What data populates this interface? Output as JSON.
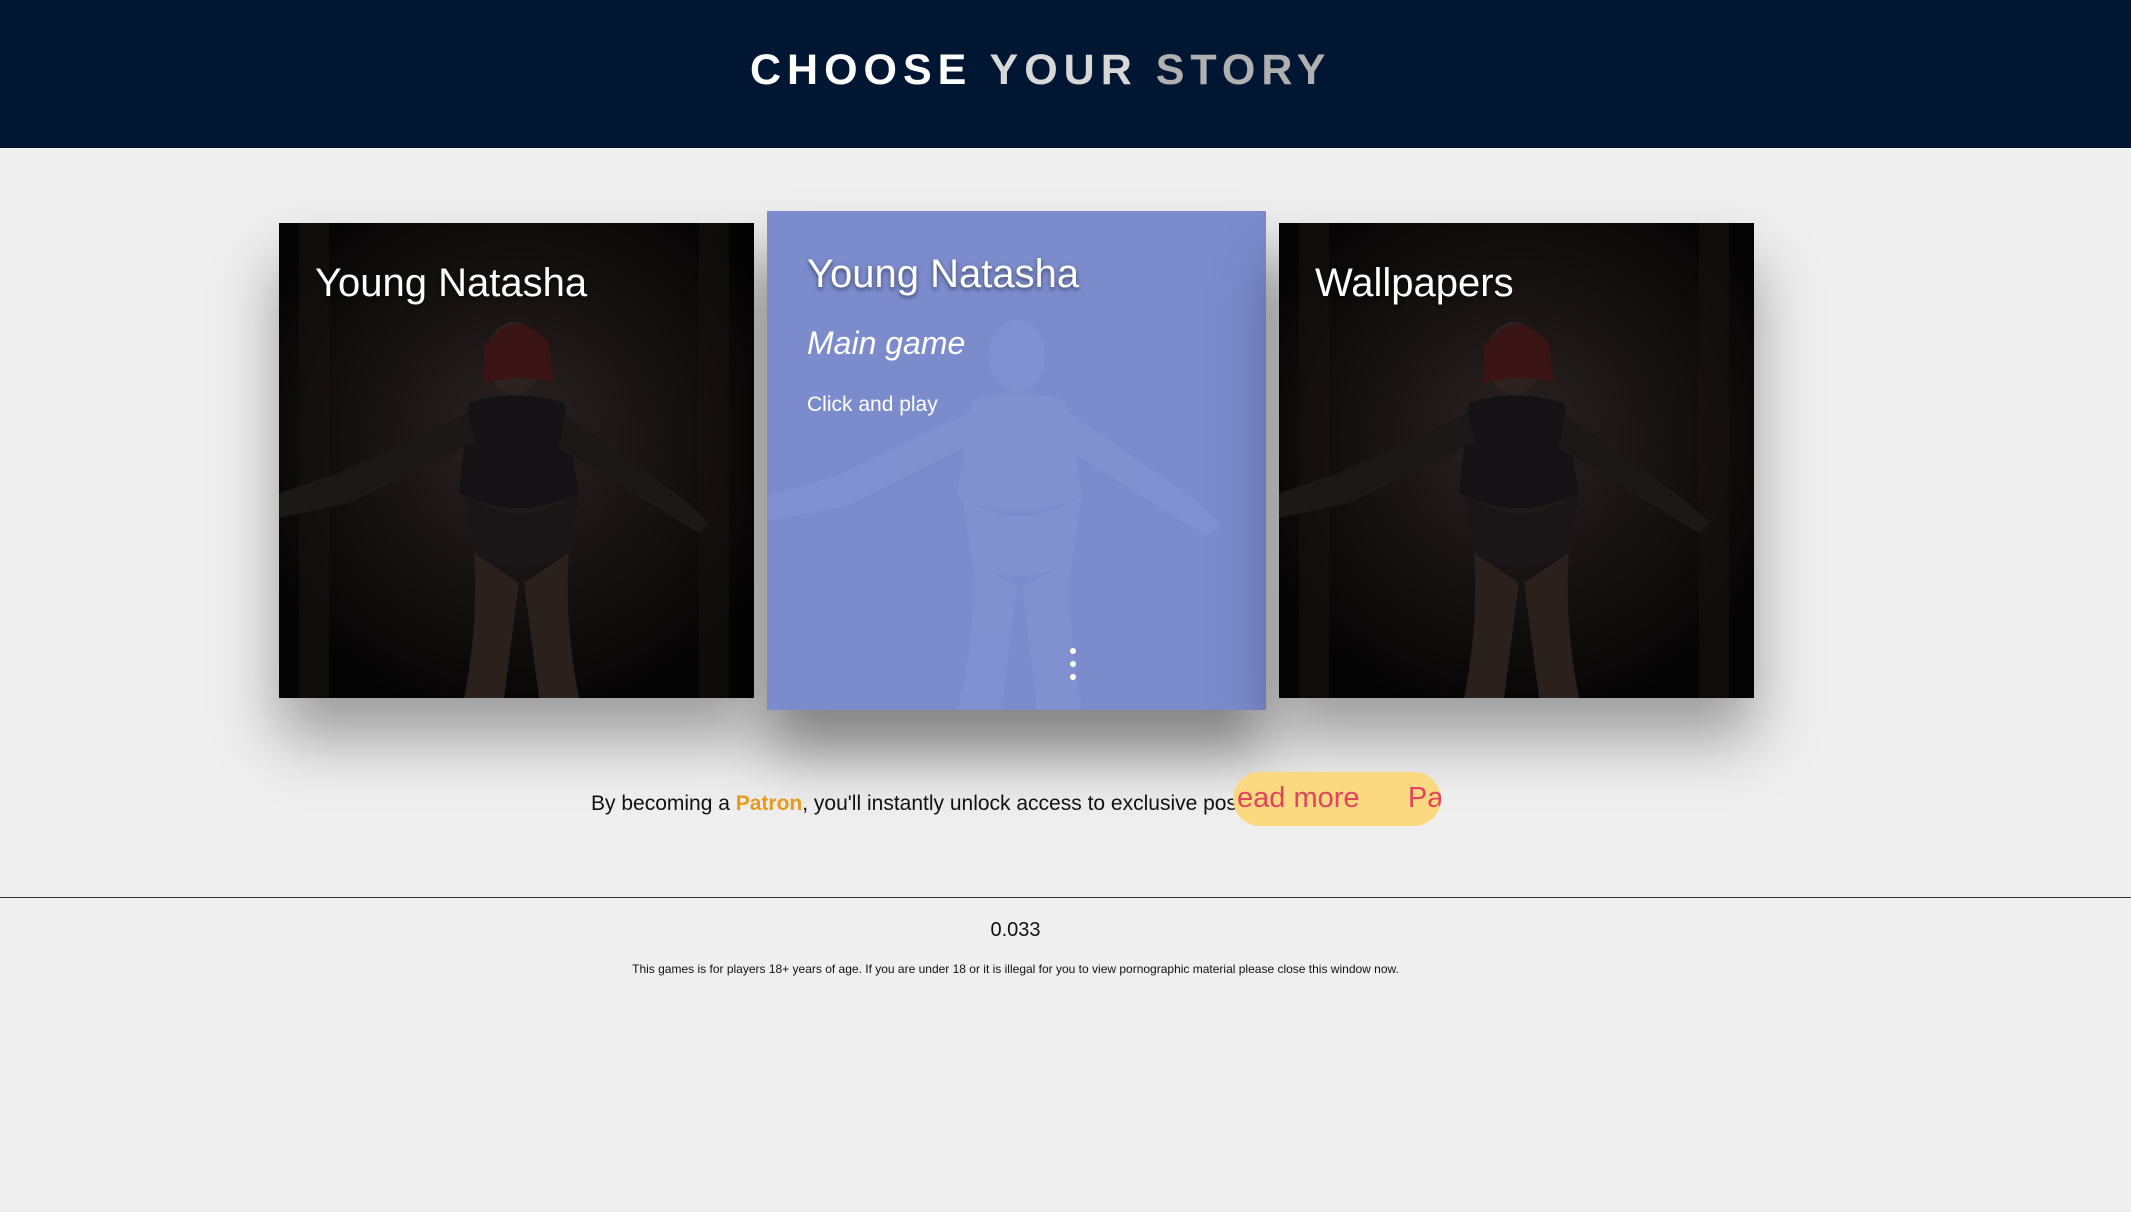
{
  "header": {
    "title_word1": "CHOOSE",
    "title_word2": "YOUR",
    "title_word3": "STORY"
  },
  "cards": [
    {
      "title": "Young Natasha"
    },
    {
      "title": "Young Natasha",
      "subtitle": "Main game",
      "hint": "Click and play"
    },
    {
      "title": "Wallpapers"
    }
  ],
  "promo": {
    "text_before": "By becoming a ",
    "patron": "Patron",
    "text_after": ", you'll instantly unlock access to exclusive posts:",
    "button_text": "ead more      Pa"
  },
  "footer": {
    "version": "0.033",
    "disclaimer": "This games is for players 18+ years of age. If you are under 18 or it is illegal for you to view pornographic material please close this window now."
  },
  "colors": {
    "header_bg": "#011633",
    "page_bg": "#efefef",
    "active_card": "#7b8bcc",
    "patron_accent": "#e79b1a",
    "button_bg": "#fbd981",
    "button_text": "#e0455f"
  }
}
